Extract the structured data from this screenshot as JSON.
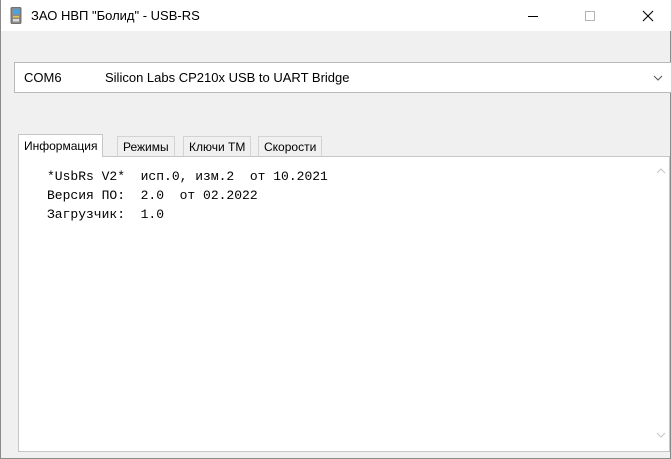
{
  "window": {
    "title": "ЗАО НВП \"Болид\" - USB-RS",
    "icon": "usb-device-icon"
  },
  "port_select": {
    "port": "COM6",
    "description": "Silicon Labs CP210x USB to UART Bridge"
  },
  "tabs": [
    {
      "label": "Информация",
      "active": true
    },
    {
      "label": "Режимы",
      "active": false
    },
    {
      "label": "Ключи ТМ",
      "active": false
    },
    {
      "label": "Скорости",
      "active": false
    }
  ],
  "info": {
    "lines": [
      "*UsbRs V2*  исп.0, изм.2  от 10.2021",
      "Версия ПО:  2.0  от 02.2022",
      "Загрузчик:  1.0"
    ]
  }
}
